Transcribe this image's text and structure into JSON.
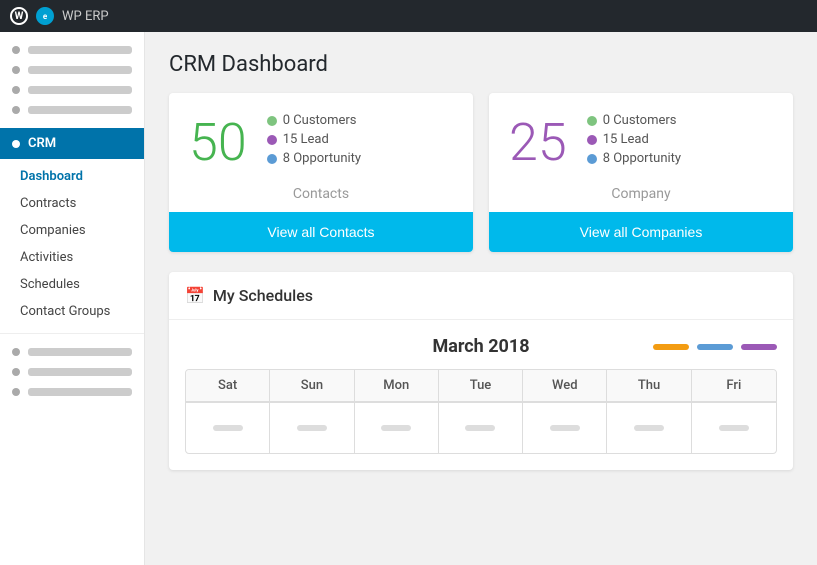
{
  "topbar": {
    "wp_label": "W",
    "erp_label": "e",
    "site_label": "WP ERP"
  },
  "sidebar": {
    "generic_items": [
      {
        "id": 1
      },
      {
        "id": 2
      },
      {
        "id": 3
      },
      {
        "id": 4
      }
    ],
    "crm_label": "CRM",
    "nav_items": [
      {
        "label": "Dashboard",
        "active": true
      },
      {
        "label": "Contracts",
        "active": false
      },
      {
        "label": "Companies",
        "active": false
      },
      {
        "label": "Activities",
        "active": false
      },
      {
        "label": "Schedules",
        "active": false
      },
      {
        "label": "Contact Groups",
        "active": false
      }
    ],
    "bottom_items": [
      {
        "id": 1
      },
      {
        "id": 2
      },
      {
        "id": 3
      }
    ]
  },
  "page": {
    "title": "CRM Dashboard"
  },
  "contacts_card": {
    "number": "50",
    "label": "Contacts",
    "stats": [
      {
        "dot_class": "green",
        "text": "0 Customers"
      },
      {
        "dot_class": "purple",
        "text": "15 Lead"
      },
      {
        "dot_class": "blue",
        "text": "8 Opportunity"
      }
    ],
    "btn_label": "View all Contacts"
  },
  "company_card": {
    "number": "25",
    "label": "Company",
    "stats": [
      {
        "dot_class": "green",
        "text": "0 Customers"
      },
      {
        "dot_class": "purple",
        "text": "15 Lead"
      },
      {
        "dot_class": "blue",
        "text": "8 Opportunity"
      }
    ],
    "btn_label": "View all Companies"
  },
  "schedules": {
    "title": "My Schedules",
    "month_year": "March 2018",
    "days": [
      "Sat",
      "Sun",
      "Mon",
      "Tue",
      "Wed",
      "Thu",
      "Fri"
    ],
    "legend": [
      {
        "class": "legend-orange"
      },
      {
        "class": "legend-blue"
      },
      {
        "class": "legend-purple"
      }
    ]
  }
}
